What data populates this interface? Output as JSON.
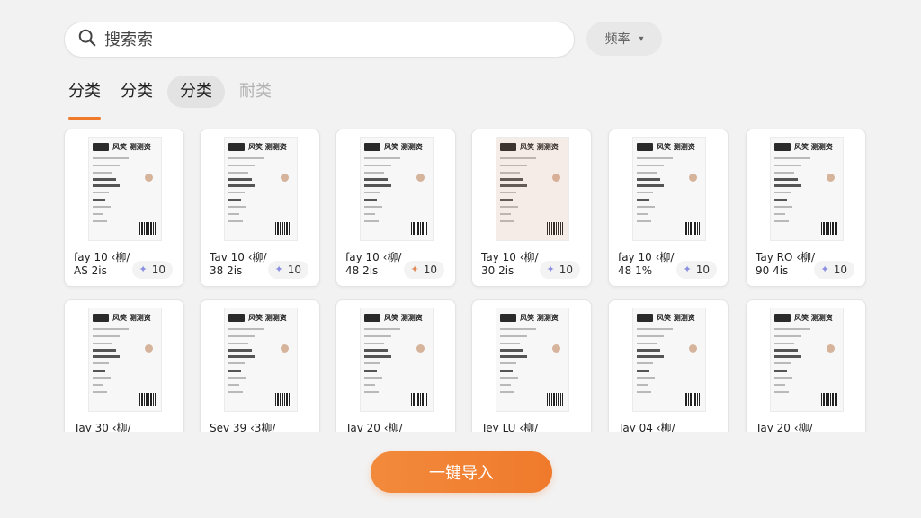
{
  "search": {
    "placeholder": "搜索索",
    "icon": "search-icon"
  },
  "sort": {
    "label": "频率",
    "icon": "chevron-down-icon"
  },
  "tabs": [
    {
      "label": "分类",
      "state": "active"
    },
    {
      "label": "分类",
      "state": "normal"
    },
    {
      "label": "分类",
      "state": "selected-pill"
    },
    {
      "label": "耐类",
      "state": "muted"
    }
  ],
  "ticket_header": "风笑 测测资",
  "cards": [
    {
      "line1": "fay 10 ‹柳/",
      "line2": "AS 2is",
      "badge": "10",
      "tint": false
    },
    {
      "line1": "Tav 10 ‹柳/",
      "line2": "38 2is",
      "badge": "10",
      "tint": false
    },
    {
      "line1": "fay 10 ‹柳/",
      "line2": "48 2is",
      "badge": "10",
      "tint": false
    },
    {
      "line1": "Tay 10 ‹柳/",
      "line2": "30 2is",
      "badge": "10",
      "tint": true
    },
    {
      "line1": "fay 10 ‹柳/",
      "line2": "48 1%",
      "badge": "10",
      "tint": false
    },
    {
      "line1": "Tay RO ‹柳/",
      "line2": "90 4is",
      "badge": "10",
      "tint": false
    },
    {
      "line1": "Tay 30 ‹柳/",
      "line2": "",
      "badge": "",
      "tint": false
    },
    {
      "line1": "Sev 39 ‹3柳/",
      "line2": "",
      "badge": "",
      "tint": false
    },
    {
      "line1": "Tav 20 ‹柳/",
      "line2": "",
      "badge": "",
      "tint": false
    },
    {
      "line1": "Tey LU ‹柳/",
      "line2": "",
      "badge": "",
      "tint": false
    },
    {
      "line1": "Tay 04 ‹柳/",
      "line2": "",
      "badge": "",
      "tint": false
    },
    {
      "line1": "Tay 20 ‹柳/",
      "line2": "",
      "badge": "",
      "tint": false
    }
  ],
  "import_button": {
    "label": "一键导入"
  },
  "colors": {
    "accent": "#f07a2c",
    "background": "#f2f2f2",
    "card": "#ffffff"
  }
}
